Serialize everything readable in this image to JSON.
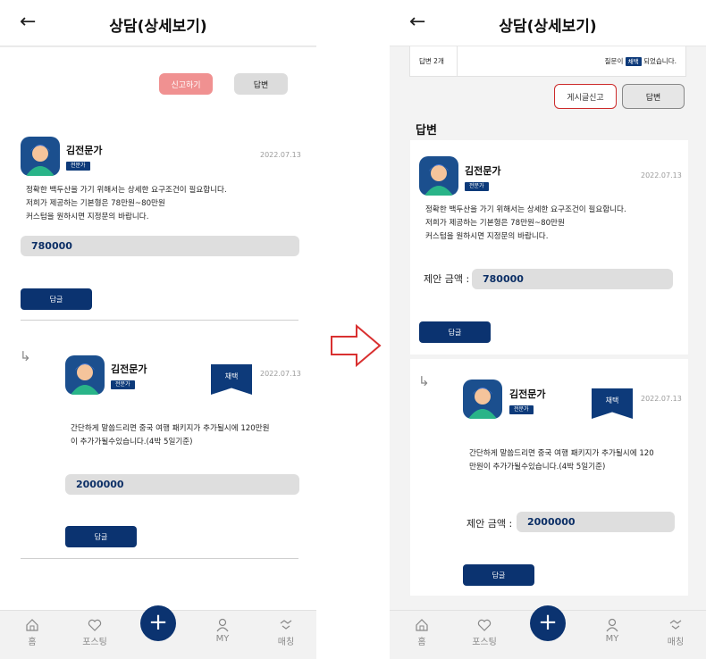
{
  "header": {
    "title": "상담(상세보기)",
    "back_icon": "arrow-left-icon"
  },
  "left": {
    "report_label": "신고하기",
    "answer_label": "답변",
    "answer1": {
      "name": "김전문가",
      "badge": "전문가",
      "date": "2022.07.13",
      "body": "정확한 백두산을 가기 위해서는 상세한 요구조건이 필요합니다.\n저희가 제공하는 기본형은 78만원~80만원\n커스텀을 원하시면 지정문의 바랍니다.",
      "amount": "780000",
      "reply_label": "답글"
    },
    "answer2": {
      "name": "김전문가",
      "badge": "전문가",
      "date": "2022.07.13",
      "ribbon": "채택",
      "body": "간단하게 말씀드리면 중국 여행 패키지가 추가될시에 120만원\n이 추가가될수있습니다.(4박 5일기준)",
      "amount": "2000000",
      "reply_label": "답글"
    }
  },
  "right": {
    "info_left": "답변 2개",
    "info_right_prefix": "질문이",
    "info_tag": "채택",
    "info_right_suffix": "되었습니다.",
    "report_label": "게시글신고",
    "answer_label": "답변",
    "section_title": "답변",
    "answer1": {
      "name": "김전문가",
      "badge": "전문가",
      "date": "2022.07.13",
      "body": "정확한 백두산을 가기 위해서는 상세한 요구조건이 필요합니다.\n저희가 제공하는 기본형은 78만원~80만원\n커스텀을 원하시면 지정문의 바랍니다.",
      "amount_label": "제안 금액 :",
      "amount": "780000",
      "reply_label": "답글"
    },
    "answer2": {
      "name": "김전문가",
      "badge": "전문가",
      "date": "2022.07.13",
      "ribbon": "채택",
      "body": "간단하게 말씀드리면 중국 여행 패키지가 추가될시에 120\n만원이 추가가될수있습니다.(4박 5일기준)",
      "amount_label": "제안 금액 :",
      "amount": "2000000",
      "reply_label": "답글"
    }
  },
  "nav": {
    "items": [
      {
        "label": "홈",
        "icon": "home-icon"
      },
      {
        "label": "포스팅",
        "icon": "posting-icon"
      },
      {
        "label": "",
        "icon": "plus-icon"
      },
      {
        "label": "MY",
        "icon": "user-icon"
      },
      {
        "label": "매칭",
        "icon": "handshake-icon"
      }
    ]
  },
  "colors": {
    "primary": "#0b3370",
    "report": "#f09191",
    "report_border": "#cc2b2b",
    "transition_arrow": "#d93030"
  }
}
